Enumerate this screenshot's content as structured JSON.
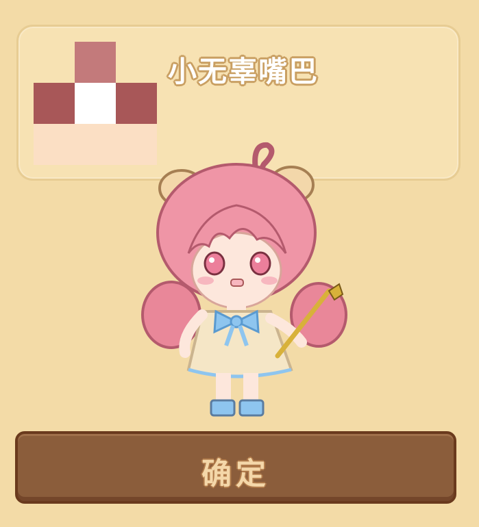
{
  "item": {
    "name": "小无辜嘴巴",
    "icon": "mouth-pixel-icon",
    "swatch_colors": [
      "#c37a7b",
      "#a85758",
      "#ffffff",
      "#fbdfc4"
    ]
  },
  "character": {
    "icon": "chibi-character-avatar",
    "hair_color": "#ea8a9c",
    "dress_color": "#f5e6c6",
    "ribbon_color": "#8ec5ef"
  },
  "confirm_button": {
    "label": "确定"
  },
  "colors": {
    "background": "#f3dba7",
    "panel": "#f7e2b3",
    "button": "#8b5d3b"
  }
}
